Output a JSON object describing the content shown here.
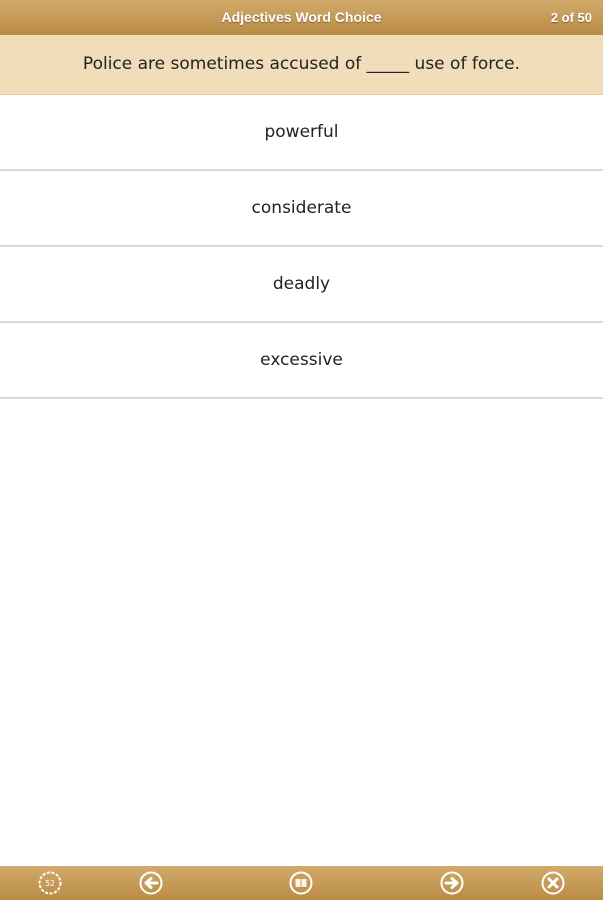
{
  "header": {
    "title": "Adjectives Word Choice",
    "counter": "2 of 50"
  },
  "question": {
    "text": "Police are sometimes accused of _____ use of force."
  },
  "options": [
    {
      "label": "powerful"
    },
    {
      "label": "considerate"
    },
    {
      "label": "deadly"
    },
    {
      "label": "excessive"
    }
  ],
  "toolbar": {
    "score_badge": "52",
    "icons": [
      "score-icon",
      "back-arrow-icon",
      "book-icon",
      "forward-arrow-icon",
      "close-icon"
    ]
  },
  "colors": {
    "bar_top": "#d2aa6a",
    "bar_bottom": "#b98b45",
    "question_background": "#f1ddb9",
    "divider": "#d7d7d7",
    "text": "#222222"
  }
}
